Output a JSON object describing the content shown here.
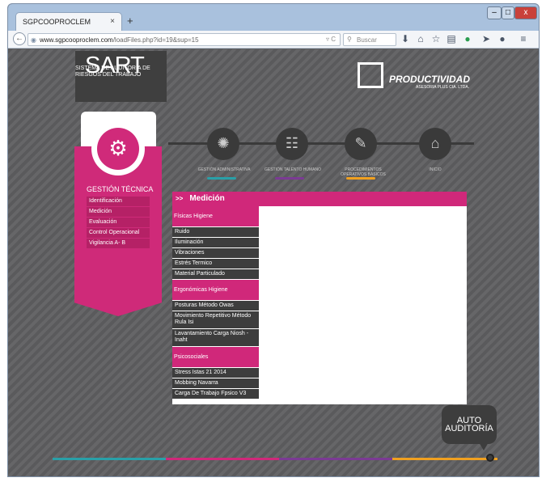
{
  "browser": {
    "tab_title": "SGPCOOPROCLEM",
    "tab_close": "×",
    "new_tab": "+",
    "url_host": "www.sgpcooproclem.com",
    "url_path": "/loadFiles.php?id=19&sup=15",
    "search_placeholder": "Buscar",
    "win_min": "–",
    "win_max": "□",
    "win_close": "x"
  },
  "brand": {
    "title": "SART",
    "subtitle": "SISTEMA DE AUDITORÍA DE RIESGOS DEL TRABAJO"
  },
  "productividad": {
    "name": "PRODUCTIVIDAD",
    "tagline": "ASESORIA PLUS CIA. LTDA."
  },
  "nav": [
    {
      "label": "GESTIÓN ADMINISTRATIVA",
      "icon": "lightbulb-icon"
    },
    {
      "label": "GESTIÓN TALENTO HUMANO",
      "icon": "people-icon"
    },
    {
      "label": "PROCEDIMIENTOS OPERATIVOS BÁSICOS",
      "icon": "clipboard-icon"
    },
    {
      "label": "INICIO",
      "icon": "home-icon"
    }
  ],
  "left_menu": {
    "heading": "GESTIÓN TÉCNICA",
    "items": [
      "Identificación",
      "Medición",
      "Evaluación",
      "Control Operacional",
      "Vigilancia A- B"
    ]
  },
  "panel": {
    "marker": ">>",
    "title": "Medición",
    "groups": [
      {
        "title": "Físicas Higiene",
        "items": [
          "Ruido",
          "Iluminación",
          "Vibraciones",
          "Estrés Termico",
          "Material Particulado"
        ]
      },
      {
        "title": "Ergonómicas Higiene",
        "items": [
          "Posturas Método Owas",
          "Movimiento Repetitivo Método Rula Isi",
          "Lavantamiento Carga Niosh - Inaht"
        ]
      },
      {
        "title": "Psicosociales",
        "items": [
          "Stress Istas 21 2014",
          "Mobbing Navarra",
          "Carga De Trabajo Fpsico V3"
        ]
      }
    ]
  },
  "auto": {
    "line1": "AUTO",
    "line2": "AUDITORÍA"
  },
  "colors": {
    "magenta": "#d0287a",
    "teal": "#29a0a8",
    "purple": "#7b3a94",
    "orange": "#f0a020"
  }
}
